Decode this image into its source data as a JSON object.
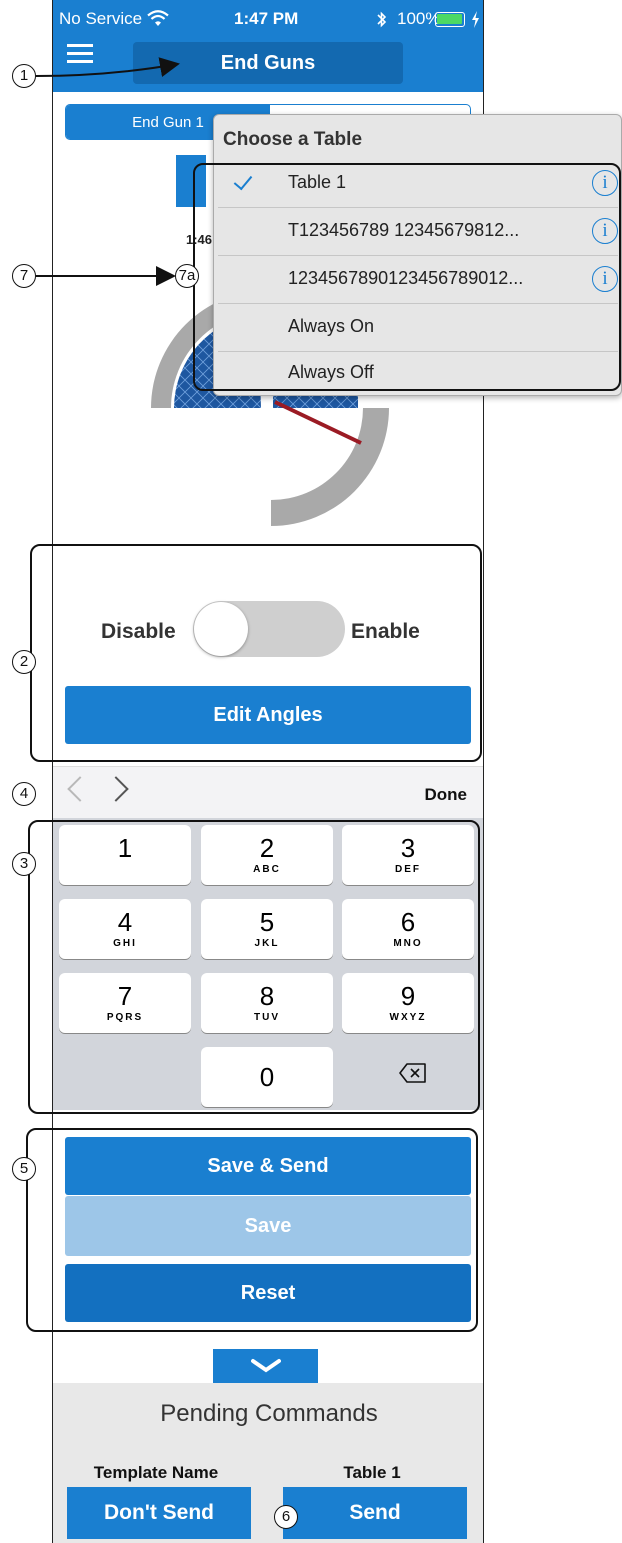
{
  "status_bar": {
    "carrier": "No Service",
    "time": "1:47 PM",
    "battery": "100%"
  },
  "nav": {
    "title": "End Guns"
  },
  "segmented": {
    "selected": "End Gun 1"
  },
  "background": {
    "time_fragment": "1:46"
  },
  "dropdown": {
    "title": "Choose a Table",
    "items": [
      {
        "label": "Table 1",
        "checked": true,
        "info": true
      },
      {
        "label": "T123456789 12345679812...",
        "checked": false,
        "info": true
      },
      {
        "label": "1234567890123456789012...",
        "checked": false,
        "info": true
      },
      {
        "label": "Always On",
        "checked": false,
        "info": false
      },
      {
        "label": "Always Off",
        "checked": false,
        "info": false
      }
    ],
    "info_glyph": "i"
  },
  "toggle_section": {
    "label": "End Gun 1",
    "off_label": "Disable",
    "on_label": "Enable",
    "enabled": false,
    "edit_button": "Edit Angles"
  },
  "keyboard_toolbar": {
    "done": "Done"
  },
  "keypad": {
    "keys": [
      {
        "num": "1",
        "letters": ""
      },
      {
        "num": "2",
        "letters": "ABC"
      },
      {
        "num": "3",
        "letters": "DEF"
      },
      {
        "num": "4",
        "letters": "GHI"
      },
      {
        "num": "5",
        "letters": "JKL"
      },
      {
        "num": "6",
        "letters": "MNO"
      },
      {
        "num": "7",
        "letters": "PQRS"
      },
      {
        "num": "8",
        "letters": "TUV"
      },
      {
        "num": "9",
        "letters": "WXYZ"
      },
      {
        "num": "0",
        "letters": ""
      }
    ]
  },
  "actions": {
    "save_send": "Save & Send",
    "save": "Save",
    "reset": "Reset"
  },
  "pending": {
    "title": "Pending Commands",
    "template_name": "Template Name",
    "table_name": "Table 1",
    "dont_send": "Don't Send",
    "send": "Send"
  },
  "callouts": {
    "c1": "1",
    "c2": "2",
    "c3": "3",
    "c4": "4",
    "c5": "5",
    "c6": "6",
    "c7": "7",
    "c7a": "7a"
  },
  "colors": {
    "primary": "#1a7fd0",
    "primary_dark": "#1369b0",
    "disabled": "#9dc6e8",
    "gauge_gray": "#a9a9a9",
    "gauge_fill": "#1e57a0",
    "needle": "#9b1b24"
  }
}
